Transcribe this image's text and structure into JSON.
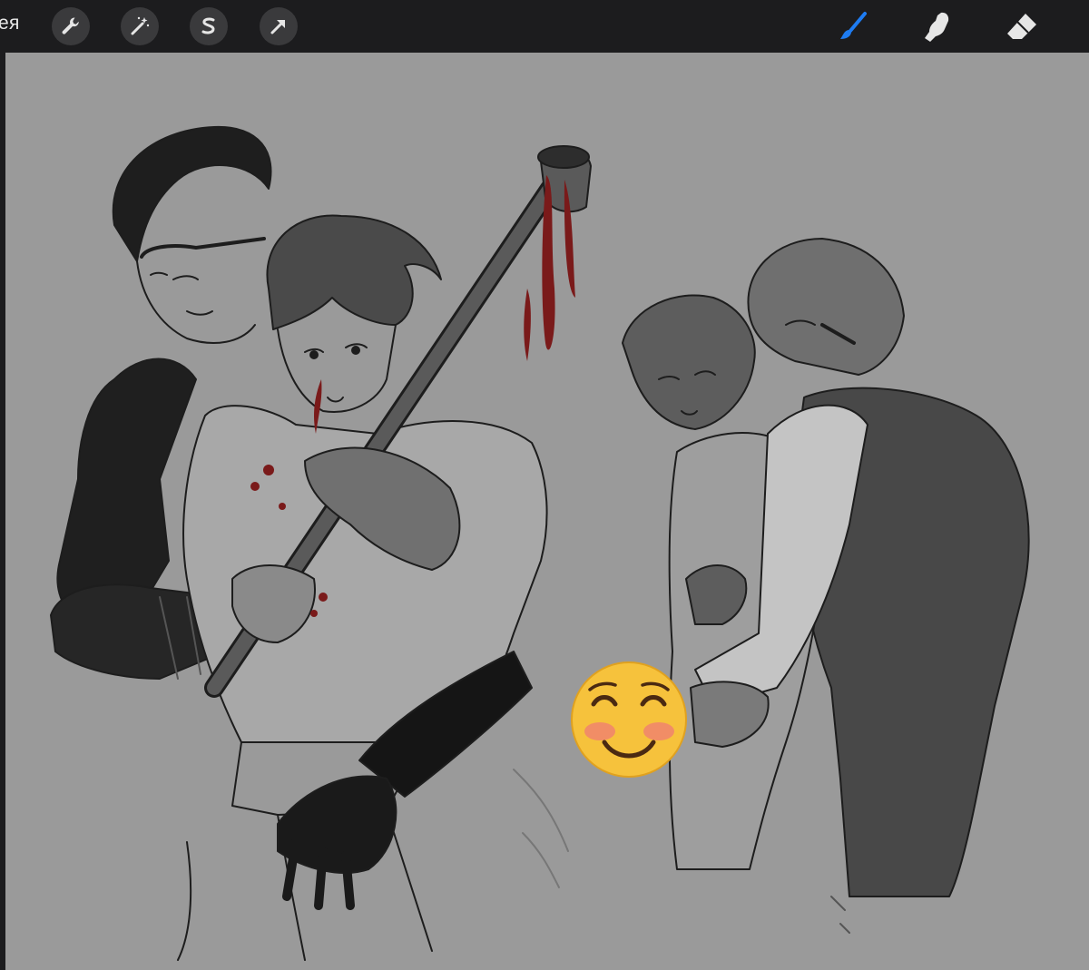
{
  "toolbar": {
    "gallery_label": "ея",
    "left_tools": [
      {
        "name": "actions",
        "icon": "wrench-icon"
      },
      {
        "name": "adjustments",
        "icon": "magic-wand-icon"
      },
      {
        "name": "selection",
        "icon": "selection-s-icon"
      },
      {
        "name": "transform",
        "icon": "arrow-cursor-icon"
      }
    ],
    "right_tools": [
      {
        "name": "paint",
        "icon": "brush-icon",
        "active": true
      },
      {
        "name": "smudge",
        "icon": "smudge-finger-icon",
        "active": false
      },
      {
        "name": "eraser",
        "icon": "eraser-icon",
        "active": false
      }
    ],
    "colors": {
      "bar": "#1c1c1e",
      "button": "#3a3a3c",
      "active": "#1e7cf2",
      "icon": "#e6e6e6"
    }
  },
  "canvas": {
    "background": "#9a9a9a",
    "content": "sketch-artwork",
    "sticker": "smiling-blush-emoji"
  }
}
